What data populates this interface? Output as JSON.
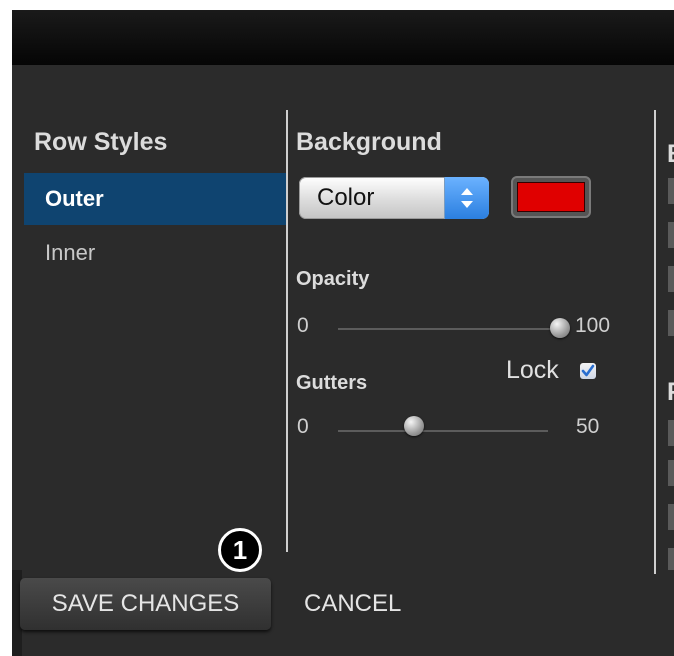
{
  "sidebar": {
    "title": "Row Styles",
    "items": [
      {
        "label": "Outer",
        "active": true
      },
      {
        "label": "Inner",
        "active": false
      }
    ]
  },
  "background": {
    "title": "Background",
    "type_select": {
      "value": "Color"
    },
    "color": "#e00000"
  },
  "opacity": {
    "label": "Opacity",
    "min": "0",
    "max": "100",
    "value": 100
  },
  "gutters": {
    "label": "Gutters",
    "min": "0",
    "max": "50",
    "value": 18,
    "lock_label": "Lock",
    "lock_checked": true
  },
  "partial_column": {
    "heading_1": "B",
    "heading_2": "F"
  },
  "actions": {
    "save_label": "SAVE CHANGES",
    "cancel_label": "CANCEL"
  },
  "callout": {
    "number": "1"
  },
  "colors": {
    "accent": "#0f4470",
    "panel": "#2b2b2b",
    "select_arrow": "#2b7fe0"
  }
}
